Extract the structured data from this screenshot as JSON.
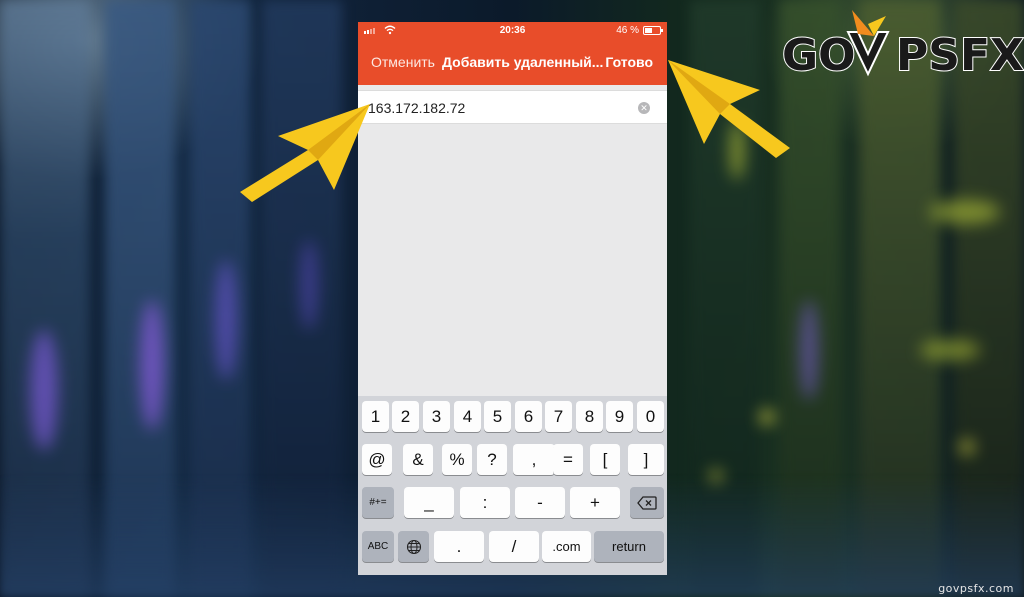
{
  "status_bar": {
    "time": "20:36",
    "battery": "46 %"
  },
  "nav": {
    "cancel_label": "Отменить",
    "title": "Добавить удаленный...",
    "done_label": "Готово"
  },
  "input": {
    "value": "163.172.182.72",
    "clear_icon": "clear-x-icon"
  },
  "keyboard": {
    "row1": [
      "1",
      "2",
      "3",
      "4",
      "5",
      "6",
      "7",
      "8",
      "9",
      "0"
    ],
    "row2": [
      "@",
      "&",
      "%",
      "?",
      ",",
      "=",
      "[",
      "]"
    ],
    "row3": {
      "shift": "#+=",
      "keys": [
        "_",
        ":",
        "-",
        "+"
      ],
      "delete_icon": "backspace-icon"
    },
    "row4": {
      "abc": "ABC",
      "globe_icon": "globe-icon",
      "keys": [
        ".",
        "/",
        ".com"
      ],
      "return": "return"
    }
  },
  "branding": {
    "logo_prefix": "GO",
    "logo_suffix": "PSFX",
    "watermark": "govpsfx.com",
    "arrow_color": "#f7c81e",
    "accent_color": "#e84d2a"
  }
}
